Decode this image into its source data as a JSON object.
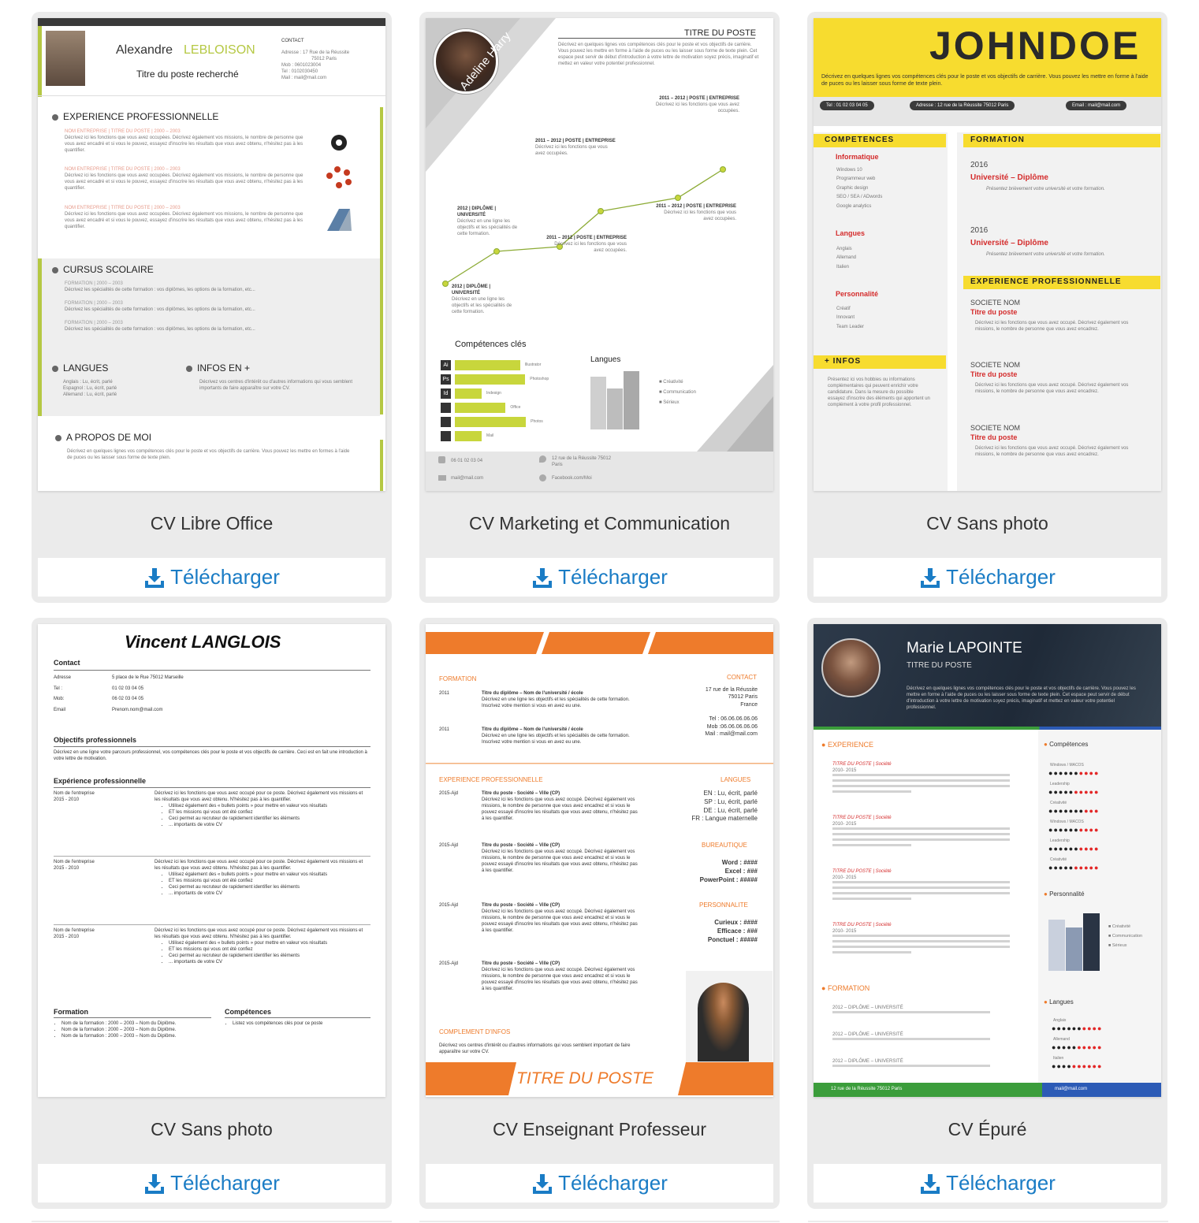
{
  "download_label": "Télécharger",
  "cards": [
    {
      "title": "CV Libre Office",
      "cv": {
        "first_name": "Alexandre",
        "last_name": "LEBLOISON",
        "job": "Titre du poste recherché",
        "contact_title": "CONTACT",
        "contact_lines": [
          "Adresse : 17 Rue de la Réussite",
          "75012 Paris",
          "Mob : 0601023004",
          "Tel : 0102030450",
          "Mail : mail@mail.com"
        ],
        "section_experience": "EXPERIENCE PROFESSIONNELLE",
        "exp_item": "NOM ENTREPRISE | TITRE DU POSTE | 2000 – 2003",
        "exp_desc": "Décrivez ici les fonctions que vous avez occupées. Décrivez également vos missions, le nombre de personne que vous avez encadré et si vous le pouvez, essayez d'inscrire les résultats que vous avez obtenu, n'hésitez pas à les quantifier.",
        "section_cursus": "CURSUS SCOLAIRE",
        "formation_item": "FORMATION | 2000 – 2003",
        "formation_desc": "Décrivez les spécialités de cette formation : vos diplômes, les options de la formation, etc...",
        "section_langues": "LANGUES",
        "langues": [
          "Anglais : Lu, écrit, parlé",
          "Espagnol : Lu, écrit, parlé",
          "Allemand : Lu, écrit, parlé"
        ],
        "section_infos": "INFOS EN +",
        "infos_desc": "Décrivez vos centres d'intérêt ou d'autres informations qui vous semblent importants de faire apparaître sur votre CV.",
        "section_apropos": "A PROPOS DE MOI",
        "apropos_desc": "Décrivez en quelques lignes vos compétences clés pour le poste et vos objectifs de carrière. Vous pouvez les mettre en formes à l'aide de puces ou les laisser sous forme de texte plein."
      }
    },
    {
      "title": "CV Marketing et Communication",
      "cv": {
        "name": "Adeline Harry",
        "job": "TITRE DU POSTE",
        "intro": "Décrivez en quelques lignes vos compétences clés pour le poste et vos objectifs de carrière. Vous pouvez les mettre en forme à l'aide de puces ou les laisser sous forme de texte plein. Cet espace peut servir de début d'introduction à votre lettre de motivation soyez précis, imaginatif et mettez en valeur votre potentiel professionnel.",
        "timeline": [
          {
            "date": "2012 | DIPLÔME | UNIVERSITÉ",
            "desc": "Décrivez en une ligne les objectifs et les spécialités de cette formation."
          },
          {
            "date": "2012 | DIPLÔME | UNIVERSITÉ",
            "desc": "Décrivez en une ligne les objectifs et les spécialités de cette formation."
          },
          {
            "date": "2011 – 2012 | POSTE | ENTREPRISE",
            "desc": "Décrivez ici les fonctions que vous avez occupées."
          },
          {
            "date": "2011 – 2012 | POSTE | ENTREPRISE",
            "desc": "Décrivez ici les fonctions que vous avez occupées."
          },
          {
            "date": "2011 – 2012 | POSTE | ENTREPRISE",
            "desc": "Décrivez ici les fonctions que vous avez occupées."
          },
          {
            "date": "2011 – 2012 | POSTE | ENTREPRISE",
            "desc": "Décrivez ici les fonctions que vous avez occupées."
          }
        ],
        "skills_title": "Compétences clés",
        "skills": [
          {
            "icon": "Ai",
            "label": "Illustrator",
            "level": 0.9
          },
          {
            "icon": "Ps",
            "label": "Photoshop",
            "level": 0.97
          },
          {
            "icon": "Id",
            "label": "Indesign",
            "level": 0.37
          },
          {
            "icon": "",
            "label": "Office",
            "level": 0.7
          },
          {
            "icon": "",
            "label": "Photos",
            "level": 0.98
          },
          {
            "icon": "",
            "label": "Mail",
            "level": 0.37
          }
        ],
        "langues_title": "Langues",
        "langues": [
          "Créativité",
          "Communication",
          "Sérieux"
        ],
        "phone": "06 01 02 03 04",
        "address": "12 rue de la Réussite 75012 Paris",
        "mail": "mail@mail.com",
        "facebook": "Facebook.com/Moi"
      }
    },
    {
      "title": "CV Sans photo",
      "cv": {
        "name": "JOHNDOE",
        "intro": "Décrivez en quelques lignes vos compétences clés pour le poste et vos objectifs de carrière. Vous pouvez les mettre en forme à l'aide de puces ou les laisser sous forme de texte plein.",
        "tel": "Tel : 01 02 03 04 05",
        "address": "Adresse : 12 rue de la Réussite 75012 Paris",
        "email": "Email : mail@mail.com",
        "competences_title": "COMPETENCES",
        "informatique": "Informatique",
        "informatique_items": [
          "Windows 10",
          "Programmeur web",
          "Graphic design",
          "SEO / SEA / ADwords",
          "Google analytics"
        ],
        "langues": "Langues",
        "langues_items": [
          "Anglais",
          "Allemand",
          "Italien"
        ],
        "personnalite": "Personnalité",
        "personnalite_items": [
          "Créatif",
          "Innovant",
          "Team Leader"
        ],
        "infos_title": "+ INFOS",
        "infos_desc": "Présentez ici vos hobbies ou informations complémentaires qui peuvent enrichir votre candidature. Dans la mesure du possible essayez d'inscrire des éléments qui apportent un complément à votre profil professionnel.",
        "formation_title": "FORMATION",
        "formations": [
          {
            "year": "2016",
            "degree": "Université – Diplôme",
            "desc": "Présentez brièvement votre université et votre formation."
          },
          {
            "year": "2016",
            "degree": "Université – Diplôme",
            "desc": "Présentez brièvement votre université et votre formation."
          }
        ],
        "experience_title": "EXPERIENCE PROFESSIONNELLE",
        "experiences": [
          {
            "company": "SOCIETE NOM",
            "job": "Titre du poste",
            "desc": "Décrivez ici les fonctions que vous avez occupé. Décrivez également vos missions, le nombre de personne que vous avez encadrez."
          },
          {
            "company": "SOCIETE NOM",
            "job": "Titre du poste",
            "desc": "Décrivez ici les fonctions que vous avez occupé. Décrivez également vos missions, le nombre de personne que vous avez encadrez."
          },
          {
            "company": "SOCIETE NOM",
            "job": "Titre du poste",
            "desc": "Décrivez ici les fonctions que vous avez occupé. Décrivez également vos missions, le nombre de personne que vous avez encadrez."
          }
        ]
      }
    },
    {
      "title": "CV Sans photo",
      "cv": {
        "name": "Vincent LANGLOIS",
        "contact_title": "Contact",
        "contact_rows": [
          {
            "k": "Adresse",
            "v": "5 place de le Rue 75012 Marseille"
          },
          {
            "k": "Tel :",
            "v": "01 02 03 04 05"
          },
          {
            "k": "Mob:",
            "v": "06 02 03 04 05"
          },
          {
            "k": "Email",
            "v": "Prenom.nom@mail.com"
          }
        ],
        "objectifs_title": "Objectifs professionnels",
        "objectifs_desc": "Décrivez en une ligne votre parcours professionnel, vos compétences clés pour le poste et vos objectifs de carrière. Ceci est en fait une introduction à votre lettre de motivation.",
        "experience_title": "Expérience professionnelle",
        "experience_company": "Nom de l'entreprise",
        "experience_dates": "2015 - 2010",
        "experience_desc": "Décrivez ici les fonctions que vous avez occupé pour ce poste. Décrivez également vos missions et les résultats que vous avez obtenu. N'hésitez pas à les quantifier.",
        "experience_bullets": [
          "Utilisez également des « bullets points » pour mettre en valeur vos résultats",
          "ET les missions qui vous ont été confiez",
          "Ceci permet au recruteur de rapidement identifier les éléments",
          "... importants de votre CV"
        ],
        "formation_title": "Formation",
        "formation_items": [
          "Nom de la formation : 2000 – 2003 – Nom du Diplôme.",
          "Nom de la formation : 2000 – 2003 – Nom du Diplôme.",
          "Nom de la formation : 2000 – 2003 – Nom du Diplôme."
        ],
        "competences_title": "Compétences",
        "competences_items": [
          "Listez vos compétences clés pour ce poste"
        ]
      }
    },
    {
      "title": "CV Enseignant Professeur",
      "cv": {
        "formation_title": "FORMATION",
        "formations": [
          {
            "year": "2011",
            "title": "Titre du diplôme – Nom de l'université / école",
            "desc": "Décrivez en une ligne les objectifs et les spécialités de cette formation. Inscrivez votre mention si vous en avez eu une."
          },
          {
            "year": "2011",
            "title": "Titre du diplôme – Nom de l'université / école",
            "desc": "Décrivez en une ligne les objectifs et les spécialités de cette formation. Inscrivez votre mention si vous en avez eu une."
          }
        ],
        "contact_title": "CONTACT",
        "contact_lines": [
          "17 rue de la Réussite",
          "75012 Paris",
          "France",
          "",
          "Tel : 06.06.06.06.06",
          "Mob :06.06.06.06.06",
          "Mail : mail@mail.com"
        ],
        "experience_title": "EXPERIENCE PROFESSIONNELLE",
        "experiences": [
          {
            "year": "2015-Ajd",
            "title": "Titre du poste - Société – Ville (CP)",
            "desc": "Décrivez ici les fonctions que vous avez occupé. Décrivez également vos missions, le nombre de personne que vous avez encadrez et si vous le pouvez essayé d'inscrire les résultats que vous avez obtenu, n'hésitez pas à les quantifier."
          },
          {
            "year": "2015-Ajd",
            "title": "Titre du poste - Société – Ville (CP)",
            "desc": "Décrivez ici les fonctions que vous avez occupé. Décrivez également vos missions, le nombre de personne que vous avez encadrez et si vous le pouvez essayé d'inscrire les résultats que vous avez obtenu, n'hésitez pas à les quantifier."
          },
          {
            "year": "2015-Ajd",
            "title": "Titre du poste - Société – Ville (CP)",
            "desc": "Décrivez ici les fonctions que vous avez occupé. Décrivez également vos missions, le nombre de personne que vous avez encadrez et si vous le pouvez essayé d'inscrire les résultats que vous avez obtenu, n'hésitez pas à les quantifier."
          },
          {
            "year": "2015-Ajd",
            "title": "Titre du poste - Société – Ville (CP)",
            "desc": "Décrivez ici les fonctions que vous avez occupé. Décrivez également vos missions, le nombre de personne que vous avez encadrez et si vous le pouvez essayé d'inscrire les résultats que vous avez obtenu, n'hésitez pas à les quantifier."
          }
        ],
        "langues_title": "LANGUES",
        "langues": [
          "EN : Lu, écrit, parlé",
          "SP : Lu, écrit, parlé",
          "DE : Lu, écrit, parlé",
          "FR : Langue maternelle"
        ],
        "bureautique_title": "BUREAUTIQUE",
        "bureautique": [
          "Word : ####",
          "Excel : ###",
          "PowerPoint : #####"
        ],
        "personnalite_title": "PERSONNALITE",
        "personnalite": [
          "Curieux : ####",
          "Efficace : ###",
          "Ponctuel : #####"
        ],
        "complement_title": "COMPLEMENT D'INFOS",
        "complement_desc": "Décrivez vos centres d'intérêt ou d'autres informations qui vous semblent important de faire apparaître sur votre CV.",
        "banner": "TITRE DU POSTE"
      }
    },
    {
      "title": "CV Épuré",
      "cv": {
        "name": "Marie LAPOINTE",
        "job": "TITRE DU POSTE",
        "intro": "Décrivez en quelques lignes vos compétences clés pour le poste et vos objectifs de carrière. Vous pouvez les mettre en forme à l'aide de puces ou les laisser sous forme de texte plein. Cet espace peut servir de début d'introduction à votre lettre de motivation soyez précis, imaginatif et mettez en valeur votre potentiel professionnel.",
        "experience_title": "EXPERIENCE",
        "exp_item": "TITRE DU POSTE | Société",
        "exp_dates": "2010- 2015",
        "formation_title": "FORMATION",
        "formation_item": "2012 – DIPLÔME – UNIVERSITÉ",
        "competences_title": "Compétences",
        "skills": [
          {
            "label": "Windows / MACOS",
            "level": 6
          },
          {
            "label": "Leadership",
            "level": 5
          },
          {
            "label": "Créativité",
            "level": 7
          },
          {
            "label": "Windows / MACOS",
            "level": 6
          },
          {
            "label": "Leadership",
            "level": 6
          },
          {
            "label": "Créativité",
            "level": 5
          }
        ],
        "personnalite_title": "Personnalité",
        "personnalite_legend": [
          "Créativité",
          "Communication",
          "Sérieux"
        ],
        "langues_title": "Langues",
        "langues": [
          {
            "label": "Anglais",
            "level": 6
          },
          {
            "label": "Allemand",
            "level": 5
          },
          {
            "label": "Italien",
            "level": 4
          }
        ],
        "footer_address": "12 rue de la Réussite 75012 Paris",
        "footer_mail": "mail@mail.com"
      }
    }
  ],
  "colors": {
    "download_blue": "#1a7cc5",
    "card_bg": "#ebebeb",
    "lime": "#b5c843",
    "yellow": "#f7dc2f",
    "orange": "#ee7b2b",
    "red": "#d42c2c",
    "navy": "#2a3444"
  }
}
